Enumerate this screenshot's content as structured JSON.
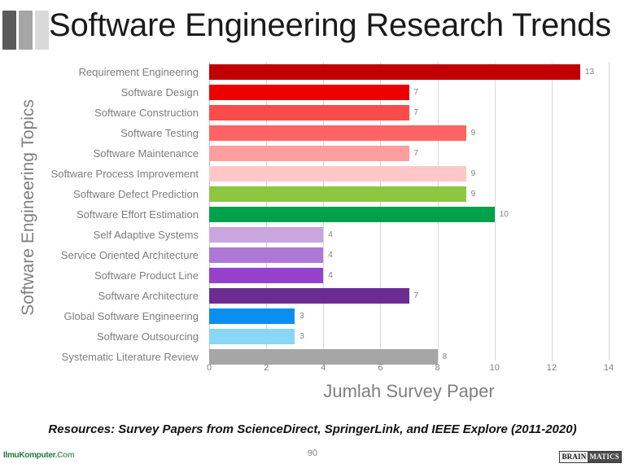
{
  "slide": {
    "title": "Software Engineering Research Trends",
    "page_number": "90",
    "footer_note": "Resources: Survey Papers from ScienceDirect, SpringerLink, and IEEE Explore (2011-2020)",
    "decor_bar_colors": [
      "#5a5a5a",
      "#a6a6a6",
      "#d9d9d9"
    ]
  },
  "logos": {
    "left": {
      "name": "IlmuKomputer",
      "suffix": ".Com",
      "color": "#1f7a3d"
    },
    "right": {
      "part1": "BRAIN",
      "part2": "MATICS"
    }
  },
  "chart_data": {
    "type": "bar",
    "orientation": "horizontal",
    "title": "",
    "xlabel": "Jumlah Survey Paper",
    "ylabel": "Software Engineering Topics",
    "xlim": [
      0,
      14
    ],
    "xticks": [
      0,
      2,
      4,
      6,
      8,
      10,
      12,
      14
    ],
    "grid": true,
    "legend": "none",
    "categories": [
      "Requirement Engineering",
      "Software Design",
      "Software Construction",
      "Software Testing",
      "Software Maintenance",
      "Software Process Improvement",
      "Software Defect Prediction",
      "Software Effort Estimation",
      "Self Adaptive Systems",
      "Service Oriented Architecture",
      "Software Product Line",
      "Software Architecture",
      "Global Software Engineering",
      "Software Outsourcing",
      "Systematic Literature Review"
    ],
    "values": [
      13,
      7,
      7,
      9,
      7,
      9,
      9,
      10,
      4,
      4,
      4,
      7,
      3,
      3,
      8
    ],
    "colors": [
      "#C00000",
      "#EE0000",
      "#FC4B4B",
      "#FF6464",
      "#FF9E9E",
      "#FFC7C7",
      "#8DC63F",
      "#00A14B",
      "#C9A6E0",
      "#AE77D6",
      "#9442CC",
      "#6B2D91",
      "#0A8EF0",
      "#8AD6F7",
      "#A6A6A6"
    ]
  }
}
